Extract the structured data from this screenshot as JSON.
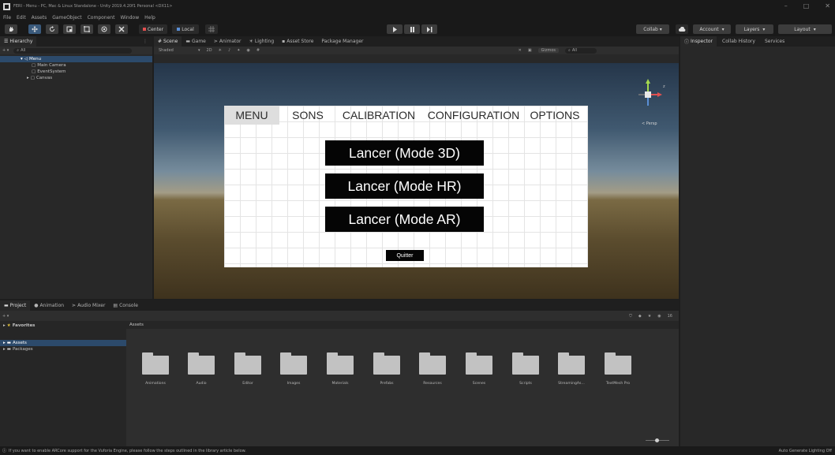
{
  "window": {
    "title": "FERI - Menu - PC, Mac & Linux Standalone - Unity 2019.4.20f1 Personal <DX11>",
    "controls": [
      "–",
      "□",
      "✕"
    ]
  },
  "menubar": [
    "File",
    "Edit",
    "Assets",
    "GameObject",
    "Component",
    "Window",
    "Help"
  ],
  "toolbar": {
    "pivot_label": "Center",
    "space_label": "Local",
    "collab_label": "Collab ▾",
    "account_label": "Account",
    "layers_label": "Layers",
    "layout_label": "Layout"
  },
  "hierarchy": {
    "tab_label": "Hierarchy",
    "create_label": "+ ▾",
    "search_placeholder": "All",
    "items": [
      {
        "label": "Menu",
        "selected": true
      },
      {
        "label": "Main Camera"
      },
      {
        "label": "EventSystem"
      },
      {
        "label": "Canvas"
      }
    ]
  },
  "scene": {
    "tabs": [
      "Scene",
      "Game",
      "Animator",
      "Lighting",
      "Asset Store",
      "Package Manager"
    ],
    "shading_mode": "Shaded",
    "twoD_label": "2D",
    "gizmos_label": "Gizmos",
    "search_placeholder": "All",
    "persp_label": "< Persp"
  },
  "ui_canvas": {
    "nav_tabs": [
      "MENU",
      "SONS",
      "CALIBRATION",
      "CONFIGURATION",
      "OPTIONS"
    ],
    "buttons": [
      "Lancer (Mode 3D)",
      "Lancer (Mode HR)",
      "Lancer (Mode AR)"
    ],
    "quit_label": "Quitter"
  },
  "inspector": {
    "tabs": [
      "Inspector",
      "Collab History",
      "Services"
    ]
  },
  "project": {
    "tabs": [
      "Project",
      "Animation",
      "Audio Mixer",
      "Console"
    ],
    "favorites_label": "Favorites",
    "tree": [
      "Assets",
      "Packages"
    ],
    "breadcrumb": "Assets",
    "folders": [
      "Animations",
      "Audio",
      "Editor",
      "Images",
      "Materials",
      "Prefabs",
      "Resources",
      "Scenes",
      "Scripts",
      "StreamingAs...",
      "TextMesh Pro"
    ],
    "asset_count": "16"
  },
  "status": {
    "message": "If you want to enable ARCore support for the Vuforia Engine, please follow the steps outlined in the library article below.",
    "right_text": "Auto Generate Lighting Off"
  },
  "colors": {
    "sky_top": "#25364a",
    "horizon": "#a39c86",
    "ground": "#3e321d",
    "selection": "#2c4a6b"
  }
}
